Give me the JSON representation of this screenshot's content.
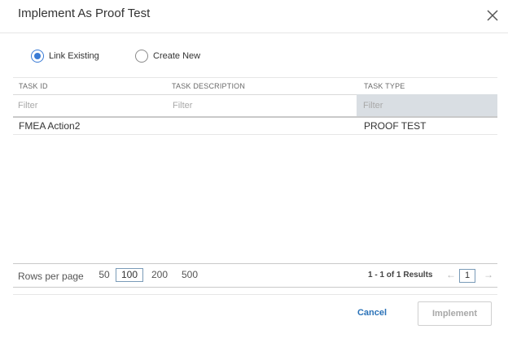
{
  "dialog": {
    "title": "Implement As Proof Test",
    "close_icon": "close-icon"
  },
  "mode": {
    "options": [
      {
        "label": "Link Existing",
        "checked": true
      },
      {
        "label": "Create New",
        "checked": false
      }
    ]
  },
  "grid": {
    "columns": [
      "TASK ID",
      "TASK DESCRIPTION",
      "TASK TYPE"
    ],
    "filter_placeholder": "Filter",
    "rows": [
      {
        "task_id": "FMEA Action2",
        "task_description": "",
        "task_type": "PROOF TEST"
      }
    ]
  },
  "pager": {
    "rows_per_page_label": "Rows per page",
    "page_sizes": [
      "50",
      "100",
      "200",
      "500"
    ],
    "selected_page_size": "100",
    "results_text": "1 - 1 of 1 Results",
    "current_page": "1",
    "prev_icon": "arrow-left-icon",
    "next_icon": "arrow-right-icon"
  },
  "actions": {
    "cancel_label": "Cancel",
    "implement_label": "Implement"
  },
  "colors": {
    "accent": "#3a7bd5",
    "link": "#2a72b8",
    "filter_active_bg": "#d9dee3"
  }
}
